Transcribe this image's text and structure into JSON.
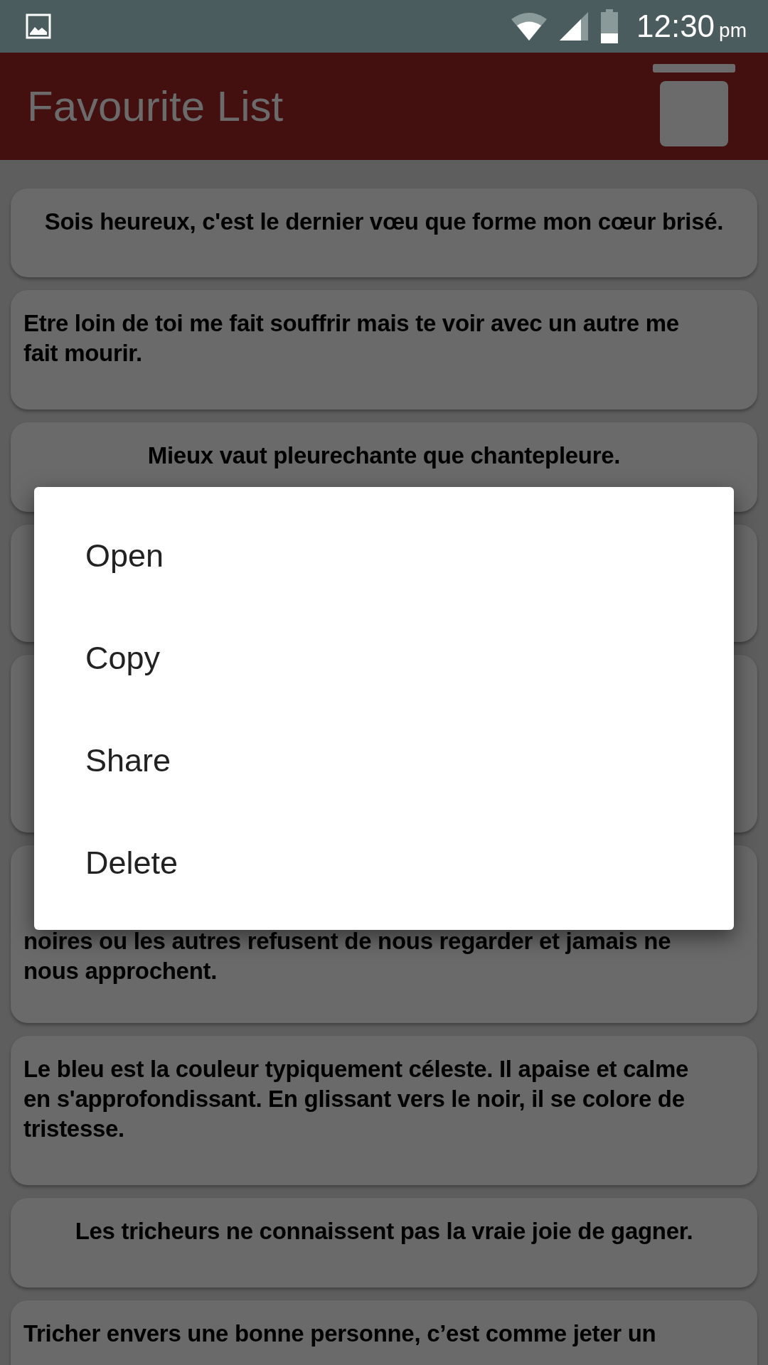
{
  "status_bar": {
    "time": "12:30",
    "period": "pm"
  },
  "app_bar": {
    "title": "Favourite List"
  },
  "cards": [
    {
      "centered": true,
      "lines": [
        "Sois heureux, c'est le dernier vœu que forme mon cœur brisé."
      ]
    },
    {
      "centered": false,
      "lines": [
        "Etre loin de toi me fait souffrir mais te voir avec un autre me",
        "fait mourir."
      ]
    },
    {
      "centered": true,
      "lines": [
        "Mieux vaut pleurechante que chantepleure."
      ]
    },
    {
      "kind": "covered"
    },
    {
      "kind": "covered"
    },
    {
      "kind": "covered",
      "centered": false,
      "lines": [
        "noires ou les autres refusent de nous regarder et jamais ne",
        "nous approchent."
      ]
    },
    {
      "centered": false,
      "lines": [
        "Le bleu est la couleur typiquement céleste. Il apaise et calme",
        "en s'approfondissant. En glissant vers le noir, il se colore de",
        "tristesse."
      ]
    },
    {
      "centered": true,
      "lines": [
        "Les tricheurs ne connaissent pas la vraie joie de gagner."
      ]
    },
    {
      "centered": false,
      "lines": [
        "Tricher envers une bonne personne, c’est comme jeter un"
      ]
    }
  ],
  "context_menu": {
    "items": [
      "Open",
      "Copy",
      "Share",
      "Delete"
    ]
  }
}
